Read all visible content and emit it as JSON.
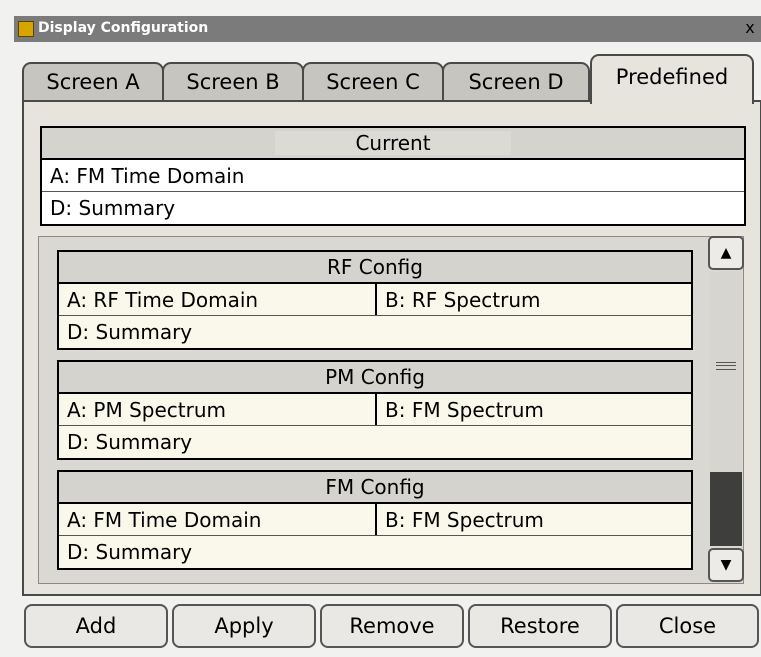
{
  "window": {
    "title": "Display Configuration",
    "close": "x"
  },
  "tabs": [
    {
      "label": "Screen A"
    },
    {
      "label": "Screen B"
    },
    {
      "label": "Screen C"
    },
    {
      "label": "Screen D"
    },
    {
      "label": "Predefined",
      "active": true
    }
  ],
  "current": {
    "header": "Current",
    "rows": [
      "A: FM Time Domain",
      "D: Summary"
    ]
  },
  "predefined": [
    {
      "header": "RF Config",
      "row1_a": "A: RF Time Domain",
      "row1_b": "B: RF Spectrum",
      "row2": "D: Summary"
    },
    {
      "header": "PM Config",
      "row1_a": "A: PM Spectrum",
      "row1_b": "B: FM Spectrum",
      "row2": "D: Summary"
    },
    {
      "header": "FM Config",
      "row1_a": "A: FM Time Domain",
      "row1_b": "B: FM Spectrum",
      "row2": "D: Summary"
    }
  ],
  "scrollbar": {
    "up": "▲",
    "down": "▼"
  },
  "buttons": {
    "add": "Add",
    "apply": "Apply",
    "remove": "Remove",
    "restore": "Restore",
    "close": "Close"
  },
  "colors": {
    "titlebar": "#7b7b7b",
    "panel": "#e6e4dd",
    "row_bg": "#f9f8ea"
  },
  "icons": {
    "app": "analyzer-app-icon"
  }
}
